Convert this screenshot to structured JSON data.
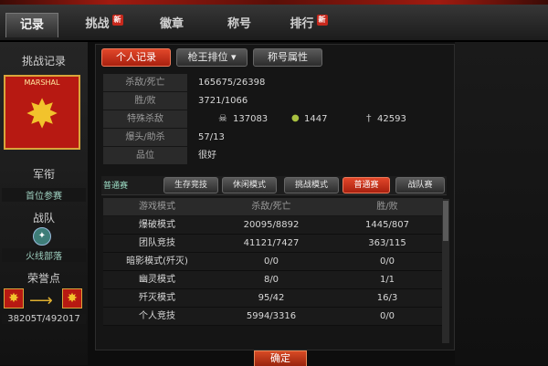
{
  "tabs": [
    {
      "label": "记录",
      "active": true,
      "badge": ""
    },
    {
      "label": "挑战",
      "active": false,
      "badge": "新"
    },
    {
      "label": "徽章",
      "active": false,
      "badge": ""
    },
    {
      "label": "称号",
      "active": false,
      "badge": ""
    },
    {
      "label": "排行",
      "active": false,
      "badge": "新"
    }
  ],
  "sidebar": {
    "section_title": "挑战记录",
    "emblem_rank": "MARSHAL",
    "medal_title": "军衔",
    "medal_value": "首位参赛",
    "team_title": "战队",
    "team_value": "火线部落",
    "honor_title": "荣誉点",
    "honor_value": "38205T/492017"
  },
  "buttons": {
    "personal_record": "个人记录",
    "ranking": "枪王排位",
    "properties": "称号属性"
  },
  "stats": [
    {
      "label": "杀敌/死亡",
      "value": "165675/26398"
    },
    {
      "label": "胜/败",
      "value": "3721/1066"
    },
    {
      "label": "特殊杀敌",
      "value": ""
    },
    {
      "label": "爆头/助杀",
      "value": "57/13"
    },
    {
      "label": "品位",
      "value": "很好"
    }
  ],
  "special_kills": {
    "headshot": "137083",
    "grenade": "1447",
    "knife": "42593"
  },
  "mode_tabs": {
    "current": "普通赛",
    "items": [
      "生存竞技",
      "休闲模式",
      "挑战模式",
      "普通赛",
      "战队赛"
    ]
  },
  "table": {
    "headers": [
      "游戏模式",
      "杀敌/死亡",
      "胜/败"
    ],
    "rows": [
      [
        "爆破模式",
        "20095/8892",
        "1445/807"
      ],
      [
        "团队竞技",
        "41121/7427",
        "363/115"
      ],
      [
        "暗影模式(歼灭)",
        "0/0",
        "0/0"
      ],
      [
        "幽灵模式",
        "8/0",
        "1/1"
      ],
      [
        "歼灭模式",
        "95/42",
        "16/3"
      ],
      [
        "个人竞技",
        "5994/3316",
        "0/0"
      ]
    ]
  },
  "confirm_label": "确定"
}
